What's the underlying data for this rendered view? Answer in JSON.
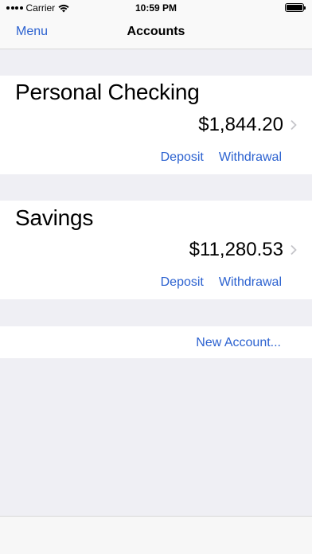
{
  "status_bar": {
    "carrier": "Carrier",
    "time": "10:59 PM"
  },
  "nav": {
    "menu_label": "Menu",
    "title": "Accounts"
  },
  "accounts": [
    {
      "name": "Personal Checking",
      "balance": "$1,844.20",
      "deposit_label": "Deposit",
      "withdrawal_label": "Withdrawal"
    },
    {
      "name": "Savings",
      "balance": "$11,280.53",
      "deposit_label": "Deposit",
      "withdrawal_label": "Withdrawal"
    }
  ],
  "new_account_label": "New Account...",
  "colors": {
    "accent": "#2c62d0",
    "background": "#efeff4",
    "card": "#ffffff"
  }
}
